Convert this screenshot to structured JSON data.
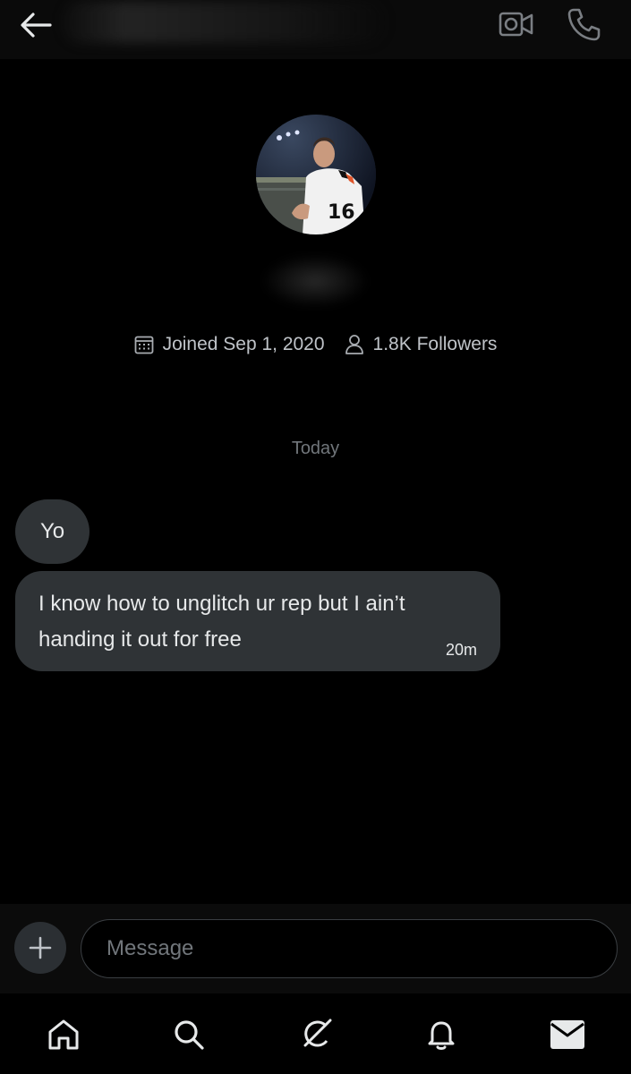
{
  "header": {
    "back_icon": "arrow-left-icon",
    "video_icon": "video-camera-icon",
    "call_icon": "phone-icon"
  },
  "profile": {
    "avatar_desc": "avatar",
    "joined_icon": "calendar-icon",
    "joined_text": "Joined Sep 1, 2020",
    "followers_icon": "person-icon",
    "followers_text": "1.8K Followers"
  },
  "conversation": {
    "date_separator": "Today",
    "messages": [
      {
        "text": "Yo"
      },
      {
        "text": "I know how to unglitch ur rep but I ain’t handing it out for free",
        "time": "20m"
      }
    ]
  },
  "composer": {
    "plus_icon": "plus-icon",
    "placeholder": "Message"
  },
  "nav": {
    "items": [
      "home-icon",
      "search-icon",
      "grok-icon",
      "bell-icon",
      "mail-icon"
    ]
  },
  "colors": {
    "background": "#000000",
    "bubble": "#2f3336",
    "text": "#e7e9ea",
    "muted": "#71767b"
  }
}
